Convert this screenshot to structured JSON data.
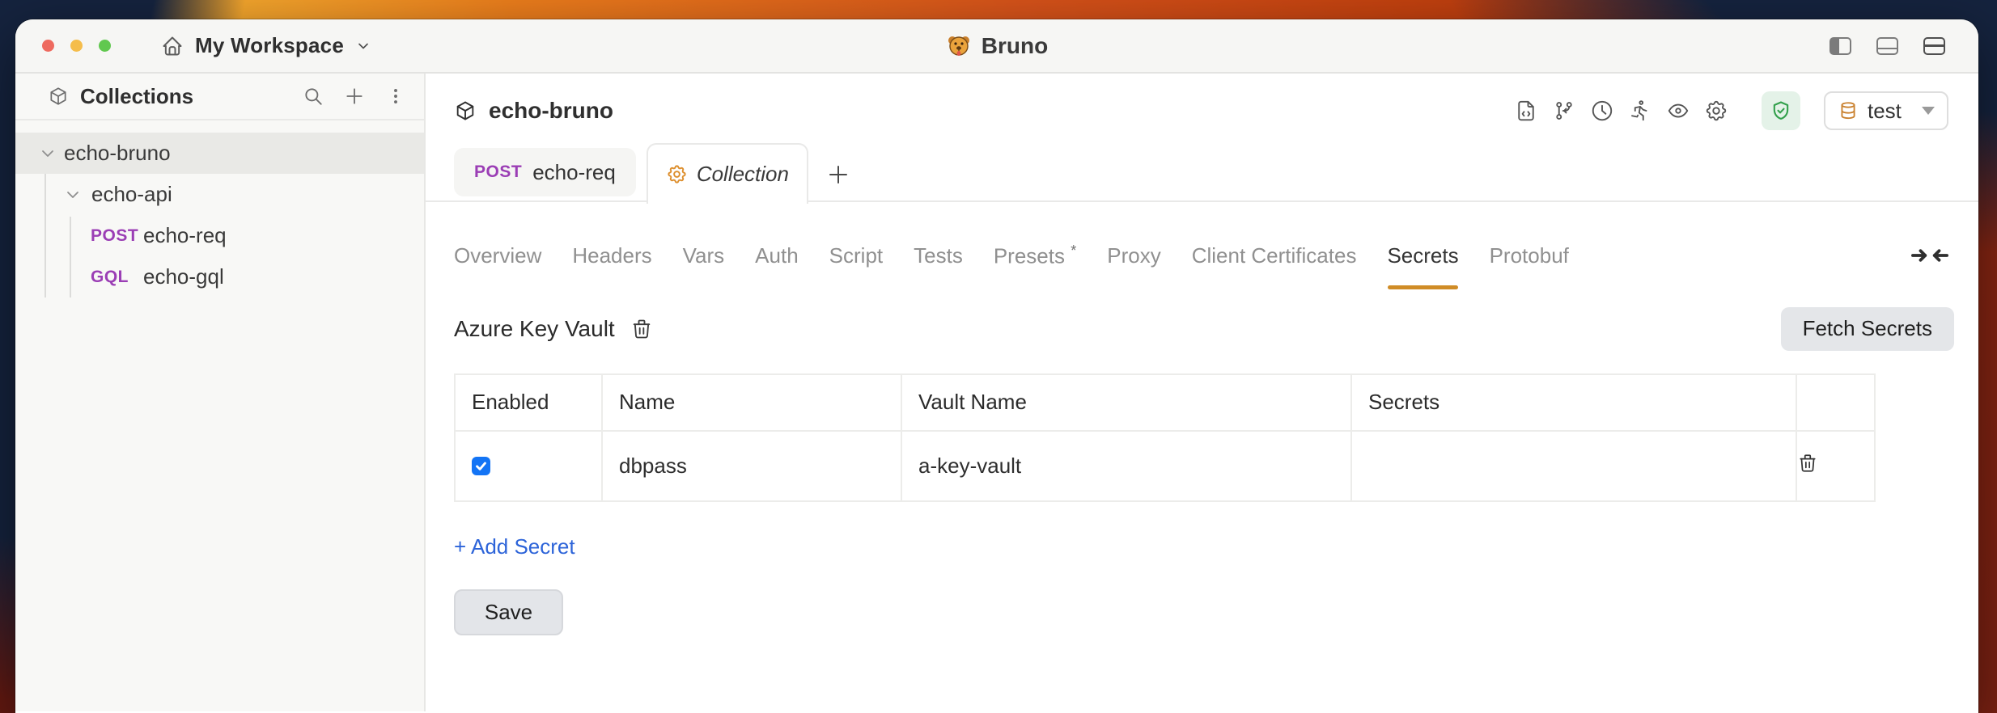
{
  "titlebar": {
    "workspace_label": "My Workspace",
    "app_name": "Bruno"
  },
  "sidebar": {
    "title": "Collections",
    "tree": {
      "root": {
        "label": "echo-bruno"
      },
      "folder": {
        "label": "echo-api"
      },
      "requests": [
        {
          "method": "POST",
          "name": "echo-req"
        },
        {
          "method": "GQL",
          "name": "echo-gql"
        }
      ]
    }
  },
  "collection_header": {
    "title": "echo-bruno",
    "environment": {
      "selected": "test"
    }
  },
  "request_tabs": {
    "tabs": [
      {
        "method": "POST",
        "label": "echo-req"
      },
      {
        "label": "Collection"
      }
    ]
  },
  "settings_nav": {
    "items": [
      {
        "label": "Overview"
      },
      {
        "label": "Headers"
      },
      {
        "label": "Vars"
      },
      {
        "label": "Auth"
      },
      {
        "label": "Script"
      },
      {
        "label": "Tests"
      },
      {
        "label": "Presets",
        "modified": "*"
      },
      {
        "label": "Proxy"
      },
      {
        "label": "Client Certificates"
      },
      {
        "label": "Secrets"
      },
      {
        "label": "Protobuf"
      }
    ],
    "active": "Secrets"
  },
  "secrets_section": {
    "provider_title": "Azure Key Vault",
    "fetch_button_label": "Fetch Secrets",
    "table": {
      "headers": {
        "enabled": "Enabled",
        "name": "Name",
        "vault_name": "Vault Name",
        "secrets": "Secrets"
      },
      "rows": [
        {
          "enabled": true,
          "name": "dbpass",
          "vault_name": "a-key-vault",
          "secrets_value": ""
        }
      ]
    },
    "add_secret_label": "+ Add Secret",
    "save_button_label": "Save"
  },
  "colors": {
    "accent_orange": "#d08c26",
    "method_color": "#9b3eb5",
    "link_blue": "#2d64d9",
    "checkbox_blue": "#1374f5",
    "shield_green": "#33a04c",
    "traffic_red": "#ee6a5f",
    "traffic_yellow": "#f5bd4b",
    "traffic_green": "#61c84f"
  }
}
